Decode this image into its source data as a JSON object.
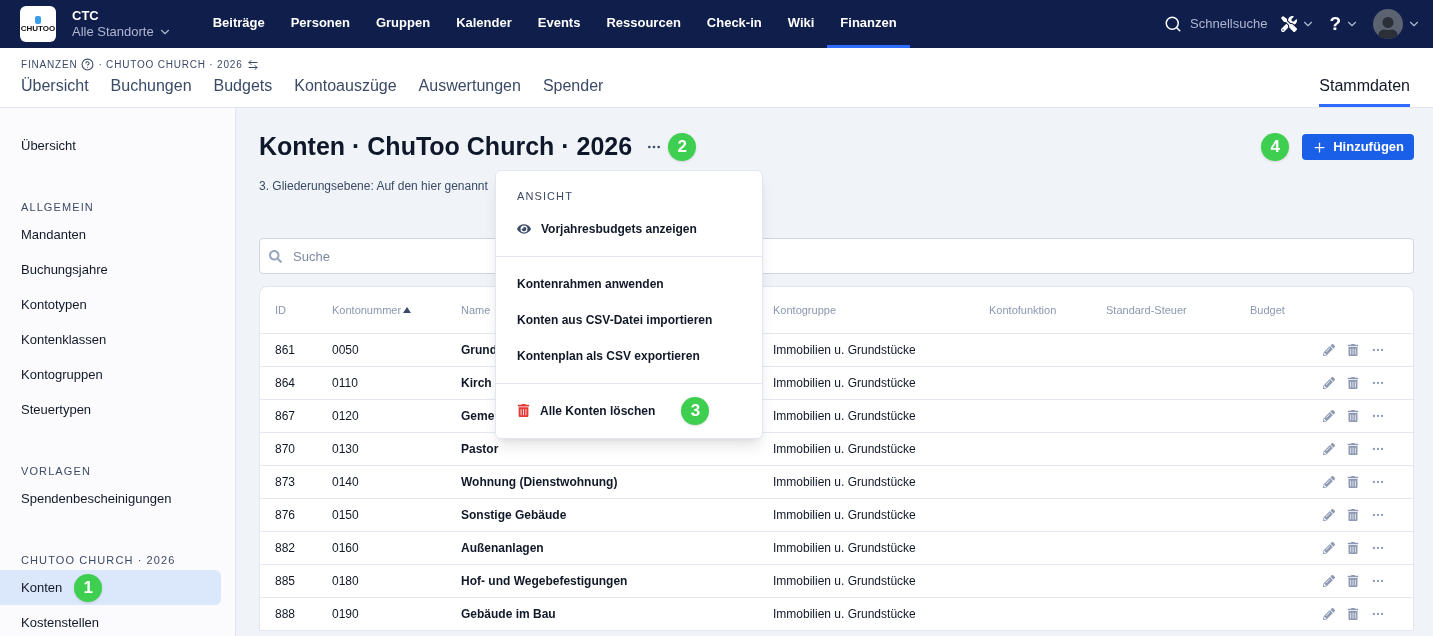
{
  "topbar": {
    "logo_text": "CHUTOO",
    "org": "CTC",
    "location": "Alle Standorte",
    "nav": [
      {
        "label": "Beiträge",
        "selected": false
      },
      {
        "label": "Personen",
        "selected": false
      },
      {
        "label": "Gruppen",
        "selected": false
      },
      {
        "label": "Kalender",
        "selected": false
      },
      {
        "label": "Events",
        "selected": false
      },
      {
        "label": "Ressourcen",
        "selected": false
      },
      {
        "label": "Check-in",
        "selected": false
      },
      {
        "label": "Wiki",
        "selected": false
      },
      {
        "label": "Finanzen",
        "selected": true
      }
    ],
    "quick_search": "Schnellsuche",
    "help": "?"
  },
  "subheader": {
    "breadcrumb_root": "FINANZEN",
    "breadcrumb_rest": "· CHUTOO CHURCH · 2026",
    "tabs": [
      {
        "label": "Übersicht",
        "selected": false
      },
      {
        "label": "Buchungen",
        "selected": false
      },
      {
        "label": "Budgets",
        "selected": false
      },
      {
        "label": "Kontoauszüge",
        "selected": false
      },
      {
        "label": "Auswertungen",
        "selected": false
      },
      {
        "label": "Spender",
        "selected": false
      }
    ],
    "right_tab": {
      "label": "Stammdaten",
      "selected": true
    }
  },
  "sidebar": {
    "sections": [
      {
        "items": [
          {
            "label": "Übersicht",
            "selected": false
          }
        ]
      },
      {
        "title": "ALLGEMEIN",
        "items": [
          {
            "label": "Mandanten",
            "selected": false
          },
          {
            "label": "Buchungsjahre",
            "selected": false
          },
          {
            "label": "Kontotypen",
            "selected": false
          },
          {
            "label": "Kontenklassen",
            "selected": false
          },
          {
            "label": "Kontogruppen",
            "selected": false
          },
          {
            "label": "Steuertypen",
            "selected": false
          }
        ]
      },
      {
        "title": "VORLAGEN",
        "items": [
          {
            "label": "Spendenbescheinigungen",
            "selected": false
          }
        ]
      },
      {
        "title": "CHUTOO CHURCH · 2026",
        "items": [
          {
            "label": "Konten",
            "selected": true,
            "badge": "1"
          },
          {
            "label": "Kostenstellen",
            "selected": false
          }
        ]
      }
    ]
  },
  "page": {
    "title": "Konten · ChuToo Church · 2026",
    "title_badge": "2",
    "description": "3. Gliederungsebene: Auf den hier genannt",
    "add_button": "Hinzufügen",
    "add_badge": "4",
    "search": {
      "placeholder": "Suche"
    }
  },
  "table": {
    "columns": [
      {
        "label": "ID",
        "sorted": false
      },
      {
        "label": "Kontonummer",
        "sorted": true
      },
      {
        "label": "Name",
        "sorted": false
      },
      {
        "label": "Kontogruppe",
        "sorted": false
      },
      {
        "label": "Kontofunktion",
        "sorted": false
      },
      {
        "label": "Standard-Steuer",
        "sorted": false
      },
      {
        "label": "Budget",
        "sorted": false
      }
    ],
    "rows": [
      {
        "id": "861",
        "number": "0050",
        "name": "Grund",
        "group": "Immobilien u. Grundstücke"
      },
      {
        "id": "864",
        "number": "0110",
        "name": "Kirch",
        "group": "Immobilien u. Grundstücke"
      },
      {
        "id": "867",
        "number": "0120",
        "name": "Geme",
        "group": "Immobilien u. Grundstücke"
      },
      {
        "id": "870",
        "number": "0130",
        "name": "Pastor",
        "group": "Immobilien u. Grundstücke"
      },
      {
        "id": "873",
        "number": "0140",
        "name": "Wohnung (Dienstwohnung)",
        "group": "Immobilien u. Grundstücke"
      },
      {
        "id": "876",
        "number": "0150",
        "name": "Sonstige Gebäude",
        "group": "Immobilien u. Grundstücke"
      },
      {
        "id": "882",
        "number": "0160",
        "name": "Außenanlagen",
        "group": "Immobilien u. Grundstücke"
      },
      {
        "id": "885",
        "number": "0180",
        "name": "Hof- und Wegebefestigungen",
        "group": "Immobilien u. Grundstücke"
      },
      {
        "id": "888",
        "number": "0190",
        "name": "Gebäude im Bau",
        "group": "Immobilien u. Grundstücke"
      }
    ]
  },
  "menu": {
    "groups": [
      {
        "title": "ANSICHT",
        "items": [
          {
            "label": "Vorjahresbudgets anzeigen",
            "kind": "view"
          }
        ]
      },
      {
        "items": [
          {
            "label": "Kontenrahmen anwenden",
            "kind": "plain"
          },
          {
            "label": "Konten aus CSV-Datei importieren",
            "kind": "plain"
          },
          {
            "label": "Kontenplan als CSV exportieren",
            "kind": "plain"
          }
        ]
      },
      {
        "items": [
          {
            "label": "Alle Konten löschen",
            "kind": "danger",
            "badge": "3"
          }
        ]
      }
    ]
  }
}
